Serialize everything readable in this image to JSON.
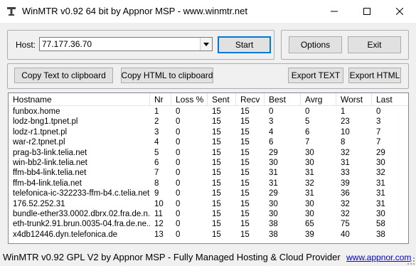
{
  "window": {
    "title": "WinMTR v0.92 64 bit by Appnor MSP - www.winmtr.net"
  },
  "host": {
    "label": "Host:",
    "value": "77.177.36.70"
  },
  "buttons": {
    "start": "Start",
    "options": "Options",
    "exit": "Exit",
    "copy_text": "Copy Text to clipboard",
    "copy_html": "Copy HTML to clipboard",
    "export_text": "Export TEXT",
    "export_html": "Export HTML"
  },
  "table": {
    "columns": [
      "Hostname",
      "Nr",
      "Loss %",
      "Sent",
      "Recv",
      "Best",
      "Avrg",
      "Worst",
      "Last"
    ],
    "rows": [
      [
        "funbox.home",
        "1",
        "0",
        "15",
        "15",
        "0",
        "0",
        "1",
        "0"
      ],
      [
        "lodz-bng1.tpnet.pl",
        "2",
        "0",
        "15",
        "15",
        "3",
        "5",
        "23",
        "3"
      ],
      [
        "lodz-r1.tpnet.pl",
        "3",
        "0",
        "15",
        "15",
        "4",
        "6",
        "10",
        "7"
      ],
      [
        "war-r2.tpnet.pl",
        "4",
        "0",
        "15",
        "15",
        "6",
        "7",
        "8",
        "7"
      ],
      [
        "prag-b3-link.telia.net",
        "5",
        "0",
        "15",
        "15",
        "29",
        "30",
        "32",
        "29"
      ],
      [
        "win-bb2-link.telia.net",
        "6",
        "0",
        "15",
        "15",
        "30",
        "30",
        "31",
        "30"
      ],
      [
        "ffm-bb4-link.telia.net",
        "7",
        "0",
        "15",
        "15",
        "31",
        "31",
        "33",
        "32"
      ],
      [
        "ffm-b4-link.telia.net",
        "8",
        "0",
        "15",
        "15",
        "31",
        "32",
        "39",
        "31"
      ],
      [
        "telefonica-ic-322233-ffm-b4.c.telia.net",
        "9",
        "0",
        "15",
        "15",
        "29",
        "31",
        "36",
        "31"
      ],
      [
        "176.52.252.31",
        "10",
        "0",
        "15",
        "15",
        "30",
        "30",
        "32",
        "31"
      ],
      [
        "bundle-ether33.0002.dbrx.02.fra.de.n...",
        "11",
        "0",
        "15",
        "15",
        "30",
        "30",
        "32",
        "30"
      ],
      [
        "eth-trunk2.91.brun.0035-04.fra.de.ne...",
        "12",
        "0",
        "15",
        "15",
        "38",
        "65",
        "75",
        "58"
      ],
      [
        "x4db12446.dyn.telefonica.de",
        "13",
        "0",
        "15",
        "15",
        "38",
        "39",
        "40",
        "38"
      ]
    ]
  },
  "status": {
    "text": "WinMTR v0.92 GPL V2 by Appnor MSP - Fully Managed Hosting & Cloud Provider",
    "link": "www.appnor.com"
  },
  "icons": {
    "app": "app-icon",
    "minimize": "minimize-icon",
    "maximize": "maximize-icon",
    "close": "close-icon",
    "dropdown": "chevron-down-icon",
    "grip": "resize-grip-icon"
  }
}
